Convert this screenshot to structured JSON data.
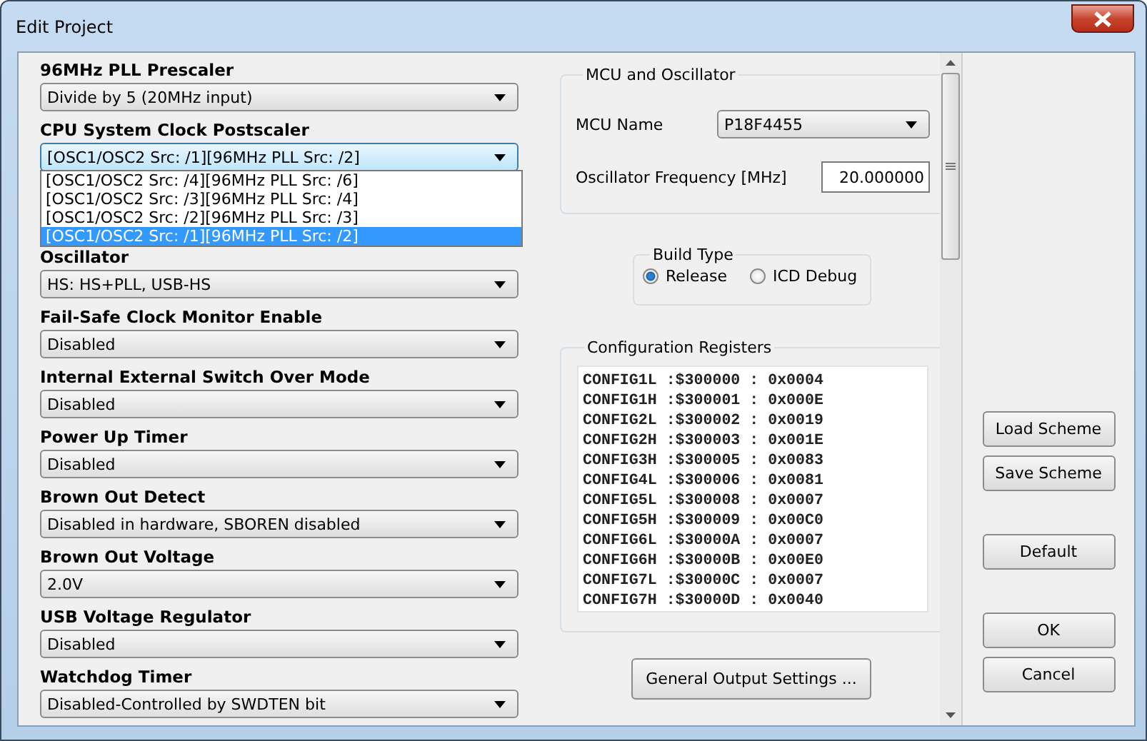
{
  "window": {
    "title": "Edit Project"
  },
  "settings": [
    {
      "label": "96MHz PLL Prescaler",
      "value": "Divide by 5 (20MHz input)"
    },
    {
      "label": "CPU System Clock Postscaler",
      "value": "[OSC1/OSC2 Src: /1][96MHz PLL Src: /2]",
      "expanded": true,
      "options": [
        {
          "label": "[OSC1/OSC2 Src: /4][96MHz PLL Src: /6]",
          "selected": false
        },
        {
          "label": "[OSC1/OSC2 Src: /3][96MHz PLL Src: /4]",
          "selected": false
        },
        {
          "label": "[OSC1/OSC2 Src: /2][96MHz PLL Src: /3]",
          "selected": false
        },
        {
          "label": "[OSC1/OSC2 Src: /1][96MHz PLL Src: /2]",
          "selected": true
        }
      ]
    },
    {
      "label": "Oscillator",
      "value": "HS: HS+PLL, USB-HS"
    },
    {
      "label": "Fail-Safe Clock Monitor Enable",
      "value": "Disabled"
    },
    {
      "label": "Internal External Switch Over Mode",
      "value": "Disabled"
    },
    {
      "label": "Power Up Timer",
      "value": "Disabled"
    },
    {
      "label": "Brown Out Detect",
      "value": "Disabled in hardware, SBOREN disabled"
    },
    {
      "label": "Brown Out Voltage",
      "value": "2.0V"
    },
    {
      "label": "USB Voltage Regulator",
      "value": "Disabled"
    },
    {
      "label": "Watchdog Timer",
      "value": "Disabled-Controlled by SWDTEN bit"
    }
  ],
  "mcu_group": {
    "title": "MCU and Oscillator",
    "mcu_name_label": "MCU Name",
    "mcu_name": "P18F4455",
    "frequency_label": "Oscillator Frequency [MHz]",
    "frequency": "20.000000"
  },
  "build_type": {
    "title": "Build Type",
    "options": [
      {
        "label": "Release",
        "selected": true
      },
      {
        "label": "ICD Debug",
        "selected": false
      }
    ]
  },
  "config_registers": {
    "title": "Configuration Registers",
    "rows": [
      {
        "name": "CONFIG1L",
        "address": ":$300000 :",
        "value": "0x0004"
      },
      {
        "name": "CONFIG1H",
        "address": ":$300001 :",
        "value": "0x000E"
      },
      {
        "name": "CONFIG2L",
        "address": ":$300002 :",
        "value": "0x0019"
      },
      {
        "name": "CONFIG2H",
        "address": ":$300003 :",
        "value": "0x001E"
      },
      {
        "name": "CONFIG3H",
        "address": ":$300005 :",
        "value": "0x0083"
      },
      {
        "name": "CONFIG4L",
        "address": ":$300006 :",
        "value": "0x0081"
      },
      {
        "name": "CONFIG5L",
        "address": ":$300008 :",
        "value": "0x0007"
      },
      {
        "name": "CONFIG5H",
        "address": ":$300009 :",
        "value": "0x00C0"
      },
      {
        "name": "CONFIG6L",
        "address": ":$30000A :",
        "value": "0x0007"
      },
      {
        "name": "CONFIG6H",
        "address": ":$30000B :",
        "value": "0x00E0"
      },
      {
        "name": "CONFIG7L",
        "address": ":$30000C :",
        "value": "0x0007"
      },
      {
        "name": "CONFIG7H",
        "address": ":$30000D :",
        "value": "0x0040"
      }
    ]
  },
  "general_output_button": "General Output Settings ...",
  "side_buttons": [
    {
      "label": "Load Scheme"
    },
    {
      "label": "Save Scheme"
    },
    {
      "label": "Default"
    },
    {
      "label": "OK"
    },
    {
      "label": "Cancel"
    }
  ]
}
